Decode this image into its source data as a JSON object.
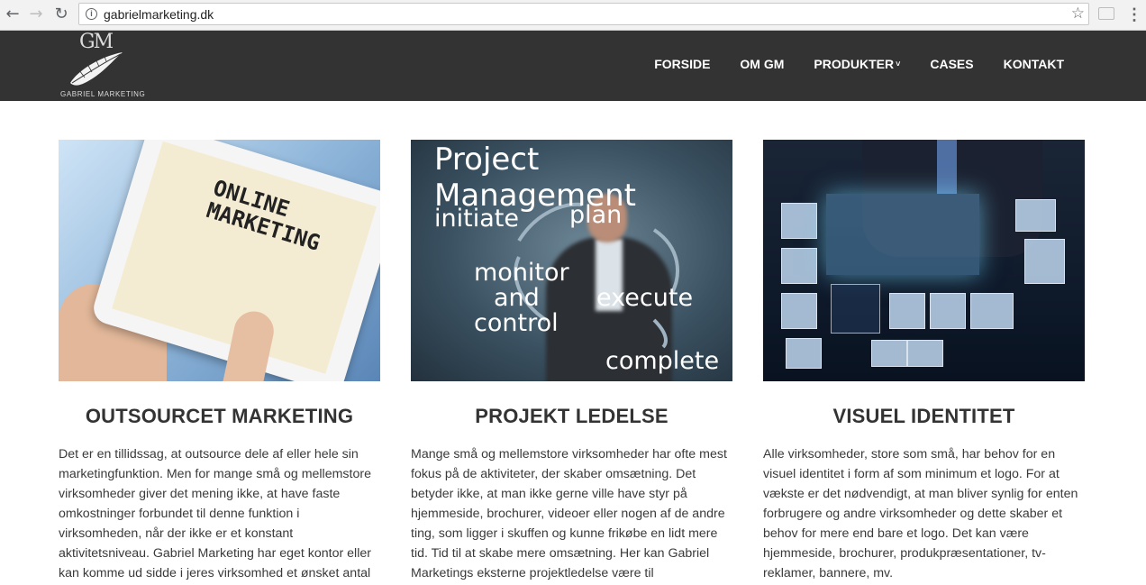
{
  "browser": {
    "url": "gabrielmarketing.dk"
  },
  "header": {
    "logo_monogram": "GM",
    "logo_text": "GABRIEL MARKETING",
    "nav": [
      {
        "label": "FORSIDE"
      },
      {
        "label": "OM GM"
      },
      {
        "label": "PRODUKTER",
        "has_dropdown": true
      },
      {
        "label": "CASES"
      },
      {
        "label": "KONTAKT"
      }
    ],
    "background_color": "#333333"
  },
  "columns": [
    {
      "image_text": {
        "line1": "ONLINE",
        "line2": "MARKETING"
      },
      "title": "OUTSOURCET MARKETING",
      "text": "Det er en tillidssag, at outsource dele af eller hele sin marketingfunktion. Men for mange små og mellemstore virksomheder giver det mening ikke, at have faste omkostninger forbundet til denne funktion i virksomheden, når der ikke er et konstant aktivitetsniveau. Gabriel Marketing har eget kontor eller kan komme ud sidde i jeres virksomhed et ønsket antal"
    },
    {
      "image_text": {
        "title": "Project Management",
        "initiate": "initiate",
        "plan": "plan",
        "monitor": "monitor",
        "and": "and",
        "control": "control",
        "execute": "execute",
        "complete": "complete"
      },
      "title": "PROJEKT LEDELSE",
      "text": "Mange små og mellemstore virksomheder har ofte mest fokus på de aktiviteter, der skaber omsætning. Det betyder ikke, at man ikke gerne ville have styr på hjemmeside, brochurer, videoer eller nogen af de andre ting, som ligger i skuffen og kunne frikøbe en lidt mere tid. Tid til at skabe mere omsætning. Her kan Gabriel Marketings eksterne projektledelse være til"
    },
    {
      "title": "VISUEL IDENTITET",
      "text": "Alle virksomheder, store som små, har behov for en visuel identitet i form af som minimum et logo. For at vækste er det nødvendigt, at man bliver synlig for enten forbrugere og andre virksomheder og dette skaber et behov for mere end bare et logo. Det kan være hjemmeside, brochurer, produkpræsentationer, tv-reklamer, bannere, mv."
    }
  ]
}
